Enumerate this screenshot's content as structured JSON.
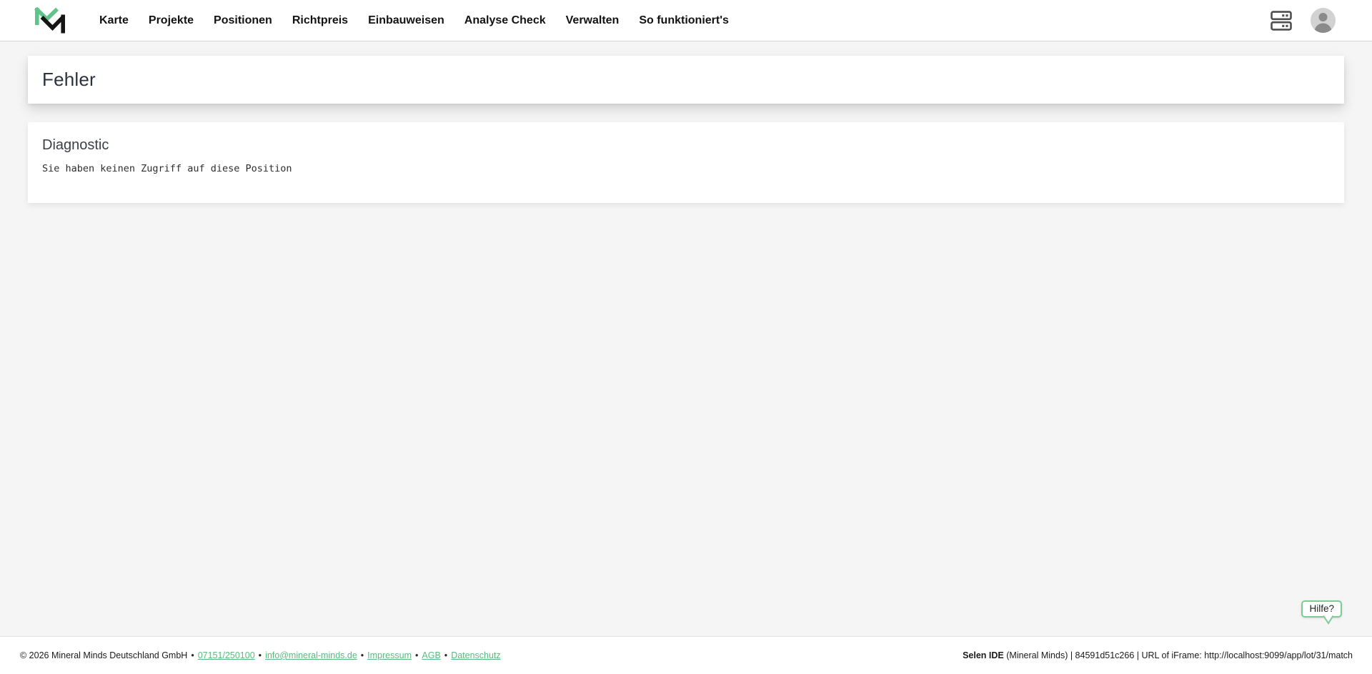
{
  "header": {
    "logo_name": "mineral-minds-logo",
    "nav_items": [
      "Karte",
      "Projekte",
      "Positionen",
      "Richtpreis",
      "Einbauweisen",
      "Analyse Check",
      "Verwalten",
      "So funktioniert's"
    ],
    "icons": [
      "server-rack-icon",
      "user-avatar-icon"
    ]
  },
  "main": {
    "page_title": "Fehler",
    "diagnostic": {
      "title": "Diagnostic",
      "message": "Sie haben keinen Zugriff auf diese Position"
    }
  },
  "help": {
    "label": "Hilfe?"
  },
  "footer": {
    "copyright": "© 2026 Mineral Minds Deutschland GmbH",
    "separator": "•",
    "links": [
      {
        "label": "07151/250100"
      },
      {
        "label": "info@mineral-minds.de"
      },
      {
        "label": "Impressum"
      },
      {
        "label": "AGB"
      },
      {
        "label": "Datenschutz"
      }
    ],
    "env_bold": "Selen IDE",
    "env_rest": " (Mineral Minds) | 84591d51c266 | URL of iFrame: http://localhost:9099/app/lot/31/match"
  },
  "colors": {
    "accent_green": "#58bb7e",
    "logo_green": "#5ec487",
    "bubble_border": "#7dcb97",
    "page_background": "#f5f5f5",
    "header_background": "#ffffff",
    "title_text": "#2c323e"
  }
}
